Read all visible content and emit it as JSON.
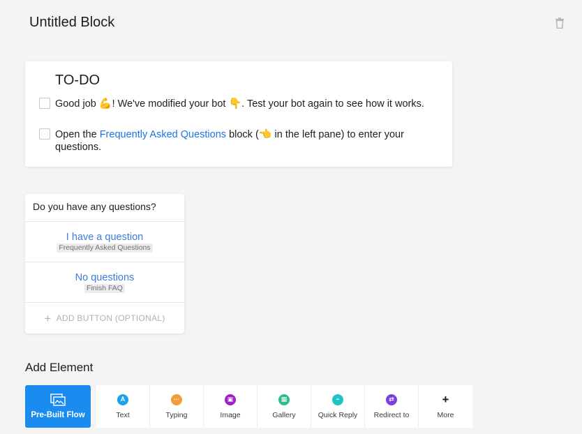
{
  "block": {
    "title": "Untitled Block"
  },
  "todo": {
    "title": "TO-DO",
    "item1": {
      "part1": "Good job ",
      "emoji1": "💪",
      "part2": "! We've modified your bot ",
      "emoji2": "👇",
      "part3": ". Test your bot again to see how it works."
    },
    "item2": {
      "part1": "Open the ",
      "link": "Frequently Asked Questions",
      "part2": " block (",
      "emoji": "👈",
      "part3": " in the left pane) to enter your questions."
    }
  },
  "quick_reply": {
    "question": "Do you have any questions?",
    "buttons": [
      {
        "label": "I have a question",
        "target": "Frequently Asked Questions"
      },
      {
        "label": "No questions",
        "target": "Finish FAQ"
      }
    ],
    "add_label": "ADD BUTTON (OPTIONAL)"
  },
  "add_element": {
    "heading": "Add Element",
    "primary": {
      "label": "Pre-Built Flow",
      "icon": "flow-icon"
    },
    "tools": [
      {
        "label": "Text",
        "icon": "text-icon",
        "color": "#1aa3e8",
        "glyph": "A"
      },
      {
        "label": "Typing",
        "icon": "typing-icon",
        "color": "#f39c3a",
        "glyph": "···"
      },
      {
        "label": "Image",
        "icon": "image-icon",
        "color": "#a020c8",
        "glyph": "▣"
      },
      {
        "label": "Gallery",
        "icon": "gallery-icon",
        "color": "#2ebc8a",
        "glyph": "▦"
      },
      {
        "label": "Quick Reply",
        "icon": "quick-reply-icon",
        "color": "#22c3c8",
        "glyph": "▪▪"
      },
      {
        "label": "Redirect to",
        "icon": "redirect-icon",
        "color": "#7c3fe0",
        "glyph": "⇄"
      },
      {
        "label": "More",
        "icon": "plus-icon",
        "color": "#1d1d1f",
        "glyph": "+"
      }
    ]
  }
}
